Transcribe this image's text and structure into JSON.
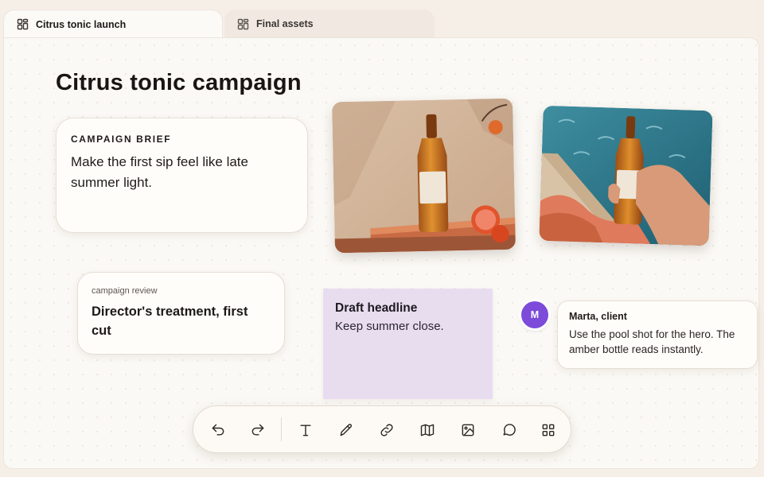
{
  "tabs": [
    {
      "label": "Citrus tonic launch",
      "icon": "board-icon",
      "active": true
    },
    {
      "label": "Final assets",
      "icon": "board-icon",
      "active": false
    }
  ],
  "board": {
    "title": "Citrus tonic campaign",
    "brief": {
      "kicker": "CAMPAIGN BRIEF",
      "text": "Make the first sip feel like late summer light."
    },
    "review": {
      "kicker": "campaign review",
      "title": "Director's treatment, first cut"
    },
    "photos": [
      {
        "subject": "amber bottle on terracotta plinth with blood orange",
        "icon": "image"
      },
      {
        "subject": "hand holding amber bottle by pool",
        "icon": "image"
      }
    ],
    "sticky": {
      "heading": "Draft headline",
      "body": "Keep summer close.",
      "color": "#e8ddef"
    },
    "comment": {
      "avatar": "M",
      "author": "Marta, client",
      "text": "Use the pool shot for the hero. The amber bottle reads instantly.",
      "avatar_color": "#7c4bd9"
    }
  },
  "toolbar": {
    "tools": [
      {
        "name": "undo",
        "icon": "undo-icon"
      },
      {
        "name": "redo",
        "icon": "redo-icon"
      },
      {
        "name": "text",
        "icon": "text-icon"
      },
      {
        "name": "pen",
        "icon": "pen-icon"
      },
      {
        "name": "link",
        "icon": "link-icon"
      },
      {
        "name": "map",
        "icon": "map-icon"
      },
      {
        "name": "image",
        "icon": "image-icon"
      },
      {
        "name": "comment",
        "icon": "comment-icon"
      },
      {
        "name": "apps",
        "icon": "grid-icon"
      }
    ]
  },
  "colors": {
    "accent": "#7c4bd9",
    "canvas": "#fbf9f5",
    "background": "#f6efe8"
  }
}
